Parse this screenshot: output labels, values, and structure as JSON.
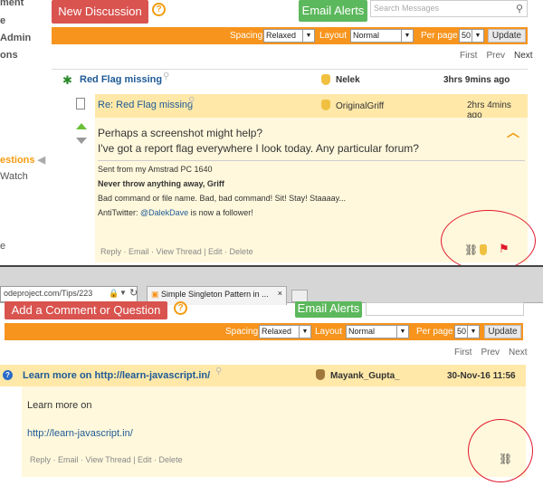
{
  "sidebar": {
    "items": [
      "ment",
      "e",
      "Admin",
      "ons",
      "estions",
      "Watch",
      "e"
    ]
  },
  "top": {
    "new_discussion": "New Discussion",
    "help_glyph": "?",
    "email_alerts": "Email Alerts",
    "search_placeholder": "Search Messages",
    "spacing_label": "Spacing",
    "spacing_value": "Relaxed",
    "layout_label": "Layout",
    "layout_value": "Normal",
    "perpage_label": "Per page",
    "perpage_value": "50",
    "update_label": "Update",
    "pager": {
      "first": "First",
      "prev": "Prev",
      "next": "Next"
    }
  },
  "thread1": {
    "title": "Red Flag missing",
    "author": "Nelek",
    "date": "3hrs 9mins ago"
  },
  "reply1": {
    "title": "Re: Red Flag missing",
    "author": "OriginalGriff",
    "date": "2hrs 4mins ago",
    "line1": "Perhaps a screenshot might help?",
    "line2": "I've got a report flag everywhere I look today. Any particular forum?",
    "sig1": "Sent from my Amstrad PC 1640",
    "sig2": "Never throw anything away, Griff",
    "sig3": "Bad command or file name. Bad, bad command! Sit! Stay! Staaaay...",
    "sig4_prefix": "AntiTwitter: ",
    "sig4_link": "@DalekDave",
    "sig4_suffix": " is now a follower!",
    "links": "Reply · Email · View Thread | Edit · Delete"
  },
  "browser": {
    "url": "odeproject.com/Tips/223",
    "tab_title": "Simple Singleton Pattern in ...",
    "tab_close": "×"
  },
  "bottom": {
    "add_comment": "Add a Comment or Question",
    "help_glyph": "?",
    "email_alerts": "Email Alerts",
    "spacing_label": "Spacing",
    "spacing_value": "Relaxed",
    "layout_label": "Layout",
    "layout_value": "Normal",
    "perpage_label": "Per page",
    "perpage_value": "50",
    "update_label": "Update",
    "pager": {
      "first": "First",
      "prev": "Prev",
      "next": "Next"
    }
  },
  "thread2": {
    "title": "Learn more on http://learn-javascript.in/",
    "author": "Mayank_Gupta_",
    "date": "30-Nov-16 11:56",
    "body1": "Learn more on",
    "body2": "http://learn-javascript.in/",
    "links": "Reply · Email · View Thread | Edit · Delete"
  },
  "colors": {
    "accent": "#f7941d",
    "red_button": "#d9534f",
    "green_button": "#5cb85c",
    "link": "#1e5a96",
    "annotation": "#e0192c"
  }
}
